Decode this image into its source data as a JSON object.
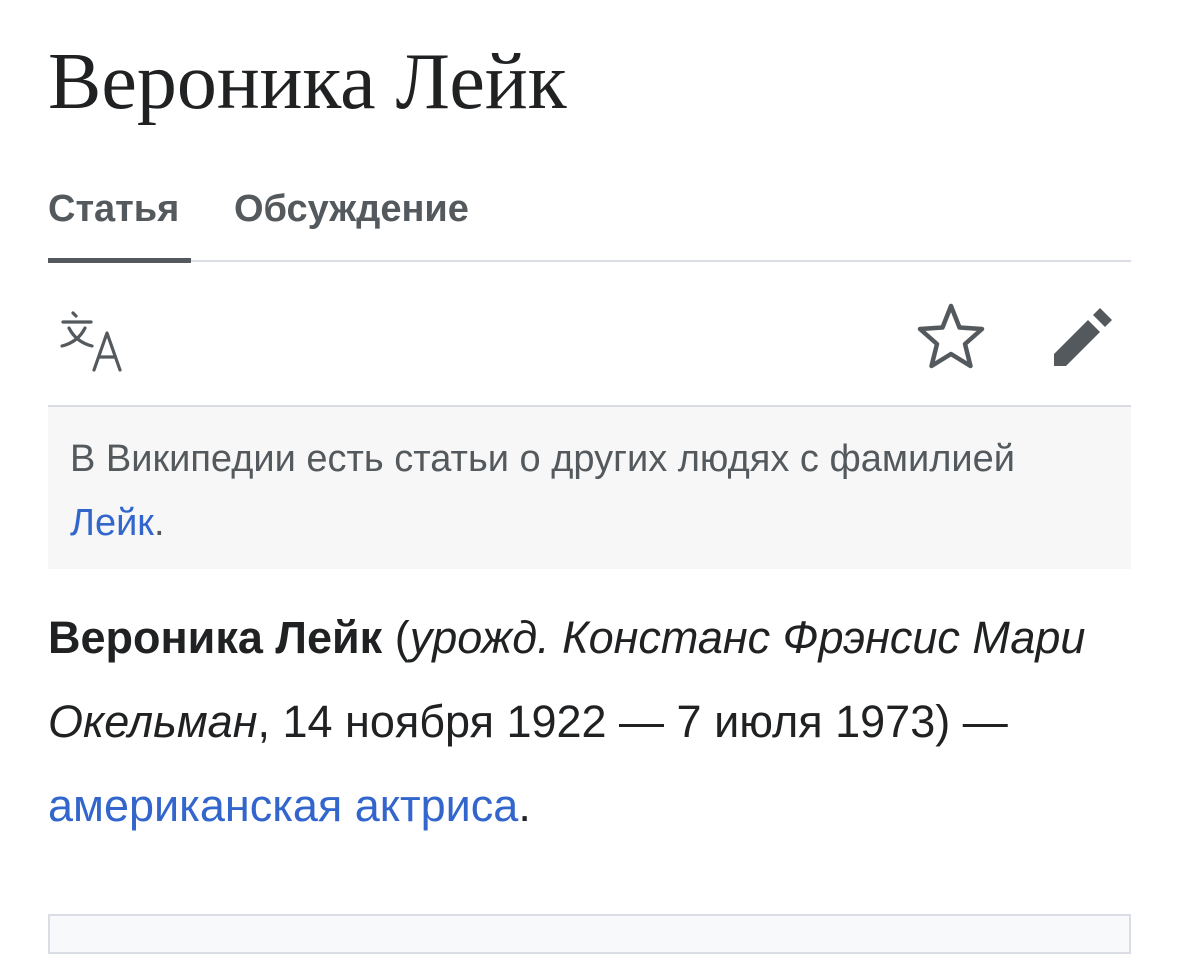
{
  "article": {
    "title": "Вероника Лейк"
  },
  "tabs": [
    {
      "label": "Статья",
      "selected": true
    },
    {
      "label": "Обсуждение",
      "selected": false
    }
  ],
  "toolbar": {
    "icons": [
      "language-icon",
      "star-icon",
      "edit-pencil-icon"
    ]
  },
  "hatnote": {
    "text_before": "В Википедии есть статьи о других людях с фамилией ",
    "link": "Лейк",
    "text_after": "."
  },
  "lead": {
    "name": "Вероника Лейк",
    "open_paren": " (",
    "born_abbr": "урожд.",
    "birth_name": " Констанс Фрэнсис Мари Окельман",
    "dates": ", 14 ноября 1922 — 7 июля 1973) — ",
    "link": "американская актриса",
    "end": "."
  },
  "colors": {
    "text": "#202122",
    "muted": "#54595d",
    "link": "#3366cc",
    "border": "#dadde3",
    "hatnote_bg": "#f6f7f6"
  }
}
